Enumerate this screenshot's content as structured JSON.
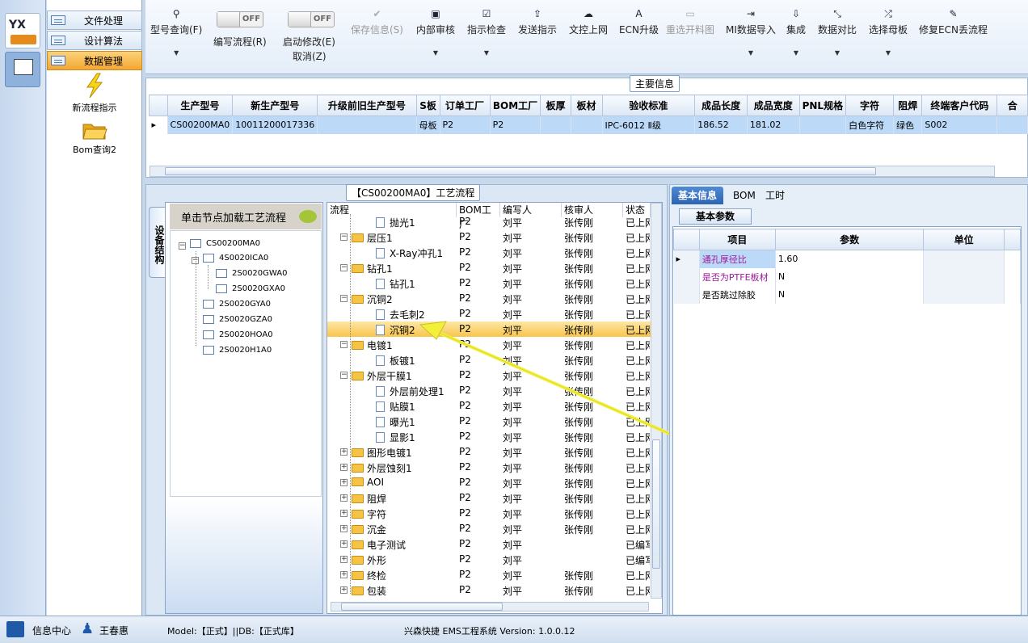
{
  "nav": {
    "items": [
      {
        "label": "文件处理"
      },
      {
        "label": "设计算法"
      },
      {
        "label": "数据管理"
      }
    ],
    "tools": [
      {
        "label": "新流程指示"
      },
      {
        "label": "Bom查询2"
      }
    ],
    "app_logo": "YX"
  },
  "toolbar": {
    "model_query": "型号查询(F)",
    "edit_flow": "编写流程(R)",
    "start_modify": "启动修改(E)",
    "cancel": "取消(Z)",
    "toggle_off": "OFF",
    "save_info": "保存信息(S)",
    "internal_review": "内部审核",
    "instruction_check": "指示检查",
    "send_instruction": "发送指示",
    "doc_upload": "文控上网",
    "ecn_upgrade": "ECN升级",
    "reselect_cutting": "重选开料图",
    "mi_import": "MI数据导入",
    "integrate": "集成",
    "data_compare": "数据对比",
    "select_mother": "选择母板",
    "fix_ecn": "修复ECN丢流程"
  },
  "main_info": {
    "title": "主要信息",
    "columns": [
      "生产型号",
      "新生产型号",
      "升级前旧生产型号",
      "S板",
      "订单工厂",
      "BOM工厂",
      "板厚",
      "板材",
      "验收标准",
      "成品长度",
      "成品宽度",
      "PNL规格",
      "字符",
      "阻焊",
      "终端客户代码",
      "合"
    ],
    "row": [
      "CS00200MA0",
      "10011200017336",
      "",
      "母板",
      "P2",
      "P2",
      "",
      "",
      "IPC-6012 Ⅱ级",
      "186.52",
      "181.02",
      "",
      "白色字符",
      "绿色",
      "S002",
      ""
    ]
  },
  "process": {
    "title": "【CS00200MA0】工艺流程",
    "side_tab": "设备结构",
    "tree_header": "单击节点加载工艺流程",
    "tree": [
      {
        "label": "CS00200MA0"
      },
      {
        "label": "4S0020ICA0"
      },
      {
        "label": "2S0020GWA0"
      },
      {
        "label": "2S0020GXA0"
      },
      {
        "label": "2S0020GYA0"
      },
      {
        "label": "2S0020GZA0"
      },
      {
        "label": "2S0020HOA0"
      },
      {
        "label": "2S0020H1A0"
      }
    ],
    "columns": [
      "流程",
      "BOM工厂",
      "编写人",
      "核审人",
      "状态"
    ],
    "rows": [
      {
        "name": "抛光1",
        "kind": "doc",
        "lvl": 2,
        "f": "P2",
        "w": "刘平",
        "r": "张传刚",
        "s": "已上网"
      },
      {
        "name": "层压1",
        "kind": "folder",
        "lvl": 1,
        "f": "P2",
        "w": "刘平",
        "r": "张传刚",
        "s": "已上网"
      },
      {
        "name": "X-Ray冲孔1",
        "kind": "doc",
        "lvl": 2,
        "f": "P2",
        "w": "刘平",
        "r": "张传刚",
        "s": "已上网"
      },
      {
        "name": "钻孔1",
        "kind": "folder",
        "lvl": 1,
        "f": "P2",
        "w": "刘平",
        "r": "张传刚",
        "s": "已上网"
      },
      {
        "name": "钻孔1",
        "kind": "doc",
        "lvl": 2,
        "f": "P2",
        "w": "刘平",
        "r": "张传刚",
        "s": "已上网"
      },
      {
        "name": "沉铜2",
        "kind": "folder",
        "lvl": 1,
        "f": "P2",
        "w": "刘平",
        "r": "张传刚",
        "s": "已上网"
      },
      {
        "name": "去毛刺2",
        "kind": "doc",
        "lvl": 2,
        "f": "P2",
        "w": "刘平",
        "r": "张传刚",
        "s": "已上网"
      },
      {
        "name": "沉铜2",
        "kind": "doc",
        "lvl": 2,
        "f": "P2",
        "w": "刘平",
        "r": "张传刚",
        "s": "已上网",
        "sel": true
      },
      {
        "name": "电镀1",
        "kind": "folder",
        "lvl": 1,
        "f": "P2",
        "w": "刘平",
        "r": "张传刚",
        "s": "已上网"
      },
      {
        "name": "板镀1",
        "kind": "doc",
        "lvl": 2,
        "f": "P2",
        "w": "刘平",
        "r": "张传刚",
        "s": "已上网"
      },
      {
        "name": "外层干膜1",
        "kind": "folder",
        "lvl": 1,
        "f": "P2",
        "w": "刘平",
        "r": "张传刚",
        "s": "已上网"
      },
      {
        "name": "外层前处理1",
        "kind": "doc",
        "lvl": 2,
        "f": "P2",
        "w": "刘平",
        "r": "张传刚",
        "s": "已上网"
      },
      {
        "name": "贴膜1",
        "kind": "doc",
        "lvl": 2,
        "f": "P2",
        "w": "刘平",
        "r": "张传刚",
        "s": "已上网"
      },
      {
        "name": "曝光1",
        "kind": "doc",
        "lvl": 2,
        "f": "P2",
        "w": "刘平",
        "r": "张传刚",
        "s": "已上网"
      },
      {
        "name": "显影1",
        "kind": "doc",
        "lvl": 2,
        "f": "P2",
        "w": "刘平",
        "r": "张传刚",
        "s": "已上网"
      },
      {
        "name": "图形电镀1",
        "kind": "folder",
        "lvl": 1,
        "plus": true,
        "f": "P2",
        "w": "刘平",
        "r": "张传刚",
        "s": "已上网"
      },
      {
        "name": "外层蚀刻1",
        "kind": "folder",
        "lvl": 1,
        "plus": true,
        "f": "P2",
        "w": "刘平",
        "r": "张传刚",
        "s": "已上网"
      },
      {
        "name": "AOI",
        "kind": "folder",
        "lvl": 1,
        "plus": true,
        "f": "P2",
        "w": "刘平",
        "r": "张传刚",
        "s": "已上网"
      },
      {
        "name": "阻焊",
        "kind": "folder",
        "lvl": 1,
        "plus": true,
        "f": "P2",
        "w": "刘平",
        "r": "张传刚",
        "s": "已上网"
      },
      {
        "name": "字符",
        "kind": "folder",
        "lvl": 1,
        "plus": true,
        "f": "P2",
        "w": "刘平",
        "r": "张传刚",
        "s": "已上网"
      },
      {
        "name": "沉金",
        "kind": "folder",
        "lvl": 1,
        "plus": true,
        "f": "P2",
        "w": "刘平",
        "r": "张传刚",
        "s": "已上网"
      },
      {
        "name": "电子测试",
        "kind": "folder",
        "lvl": 1,
        "plus": true,
        "f": "P2",
        "w": "刘平",
        "r": "",
        "s": "已编写"
      },
      {
        "name": "外形",
        "kind": "folder",
        "lvl": 1,
        "plus": true,
        "f": "P2",
        "w": "刘平",
        "r": "",
        "s": "已编写"
      },
      {
        "name": "终检",
        "kind": "folder",
        "lvl": 1,
        "plus": true,
        "f": "P2",
        "w": "刘平",
        "r": "张传刚",
        "s": "已上网"
      },
      {
        "name": "包装",
        "kind": "folder",
        "lvl": 1,
        "plus": true,
        "f": "P2",
        "w": "刘平",
        "r": "张传刚",
        "s": "已上网"
      }
    ]
  },
  "right": {
    "tabs": [
      "基本信息",
      "BOM",
      "工时"
    ],
    "subtab": "基本参数",
    "columns": [
      "项目",
      "参数",
      "单位"
    ],
    "rows": [
      {
        "item": "通孔厚径比",
        "value": "1.60",
        "unit": "",
        "color": "#9a1a9a"
      },
      {
        "item": "是否为PTFE板材",
        "value": "N",
        "unit": "",
        "color": "#9a1a9a"
      },
      {
        "item": "是否跳过除胶",
        "value": "N",
        "unit": "",
        "color": "#000000"
      }
    ]
  },
  "status": {
    "info_center": "信息中心",
    "user": "王春惠",
    "model": "Model:【正式】||DB:【正式库】",
    "app": "兴森快捷 EMS工程系统 Version: 1.0.0.12"
  },
  "colors": {
    "accent": "#f4a732",
    "selection": "#bcd9f7",
    "arrow": "#f3f03a"
  }
}
